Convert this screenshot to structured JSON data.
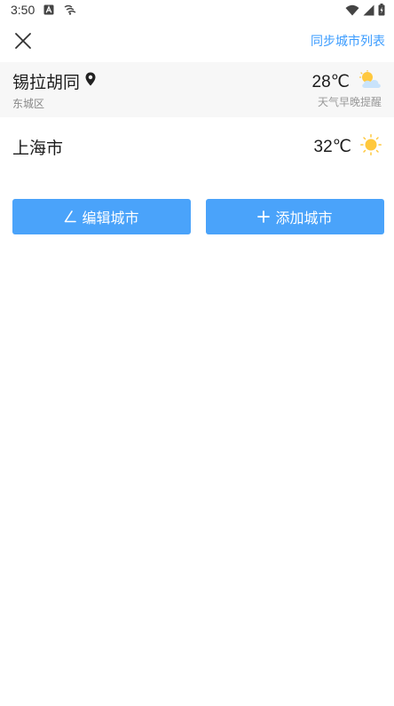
{
  "status_bar": {
    "time": "3:50",
    "icons": [
      "font-a-icon",
      "signal-waves-icon",
      "wifi-icon",
      "cell-signal-icon",
      "battery-charging-icon"
    ]
  },
  "header": {
    "close_icon": "close-icon",
    "sync_label": "同步城市列表"
  },
  "cities": [
    {
      "name": "锡拉胡同",
      "district": "东城区",
      "temperature": "28℃",
      "reminder": "天气早晚提醒",
      "weather_icon": "partly-cloudy-icon",
      "location_icon": "location-pin-icon"
    },
    {
      "name": "上海市",
      "temperature": "32℃",
      "weather_icon": "sunny-icon"
    }
  ],
  "actions": {
    "edit_label": "编辑城市",
    "add_label": "添加城市"
  },
  "colors": {
    "accent": "#4aa3fa",
    "link": "#3b9cff",
    "current_row_bg": "#f7f7f7",
    "sun": "#ffc83d"
  }
}
